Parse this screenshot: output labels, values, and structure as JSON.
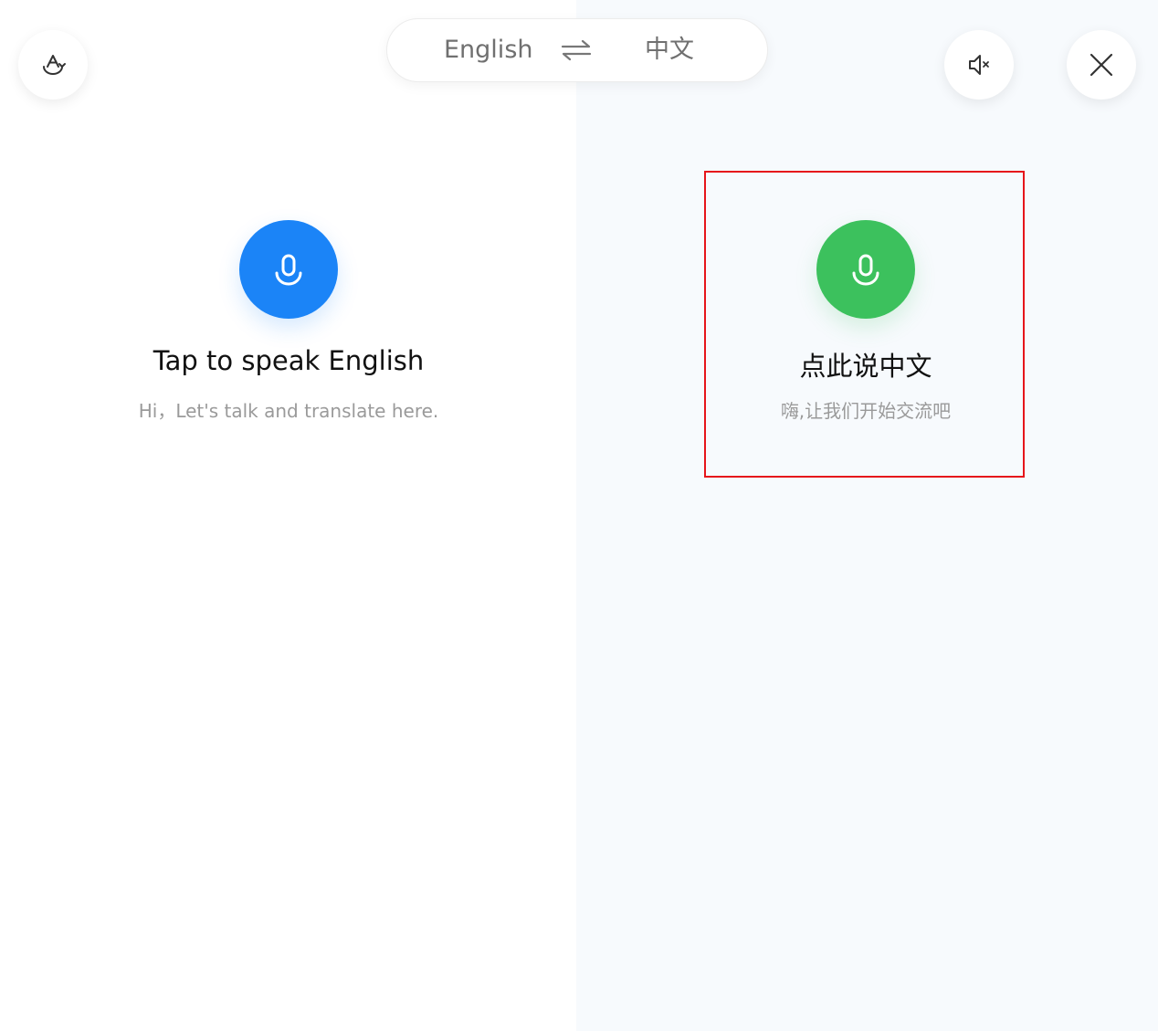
{
  "header": {
    "source_lang": "English",
    "target_lang": "中文",
    "icons": {
      "left": "translate-style-icon",
      "swap": "swap-arrows-icon",
      "mute": "speaker-mute-icon",
      "close": "close-icon"
    }
  },
  "left_panel": {
    "title": "Tap to speak English",
    "subtitle": "Hi，Let's talk and translate here.",
    "mic_color": "#1b84f7"
  },
  "right_panel": {
    "title": "点此说中文",
    "subtitle": "嗨,让我们开始交流吧",
    "mic_color": "#3cc15d"
  },
  "colors": {
    "highlight": "#e6151b",
    "right_bg": "#f7fafd"
  }
}
